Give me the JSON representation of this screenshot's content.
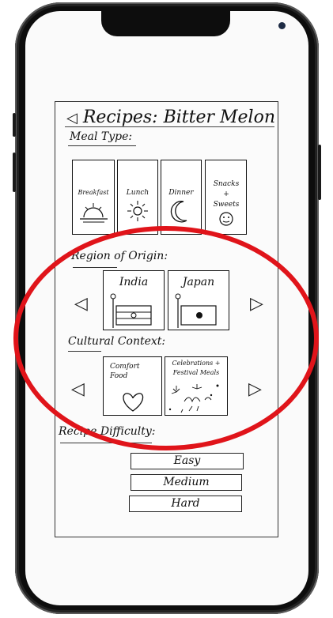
{
  "header": {
    "back_icon": "triangle-left-icon",
    "title": "Recipes: Bitter Melon"
  },
  "meal_type": {
    "label": "Meal Type:",
    "options": [
      {
        "label": "Breakfast",
        "icon": "sunrise-icon"
      },
      {
        "label": "Lunch",
        "icon": "sun-icon"
      },
      {
        "label": "Dinner",
        "icon": "moon-icon"
      },
      {
        "label": "Snacks + Sweets",
        "icon": "cookie-icon"
      }
    ]
  },
  "region": {
    "label": "Region of Origin:",
    "options": [
      {
        "label": "India",
        "icon": "india-flag-icon"
      },
      {
        "label": "Japan",
        "icon": "japan-flag-icon"
      }
    ]
  },
  "cultural": {
    "label": "Cultural Context:",
    "options": [
      {
        "label": "Comfort Food",
        "icon": "heart-icon"
      },
      {
        "label": "Celebrations + Festival Meals",
        "icon": "fireworks-icon"
      }
    ]
  },
  "difficulty": {
    "label": "Recipe Difficulty:",
    "options": [
      "Easy",
      "Medium",
      "Hard"
    ]
  },
  "annotation": {
    "color": "#e0141a"
  }
}
